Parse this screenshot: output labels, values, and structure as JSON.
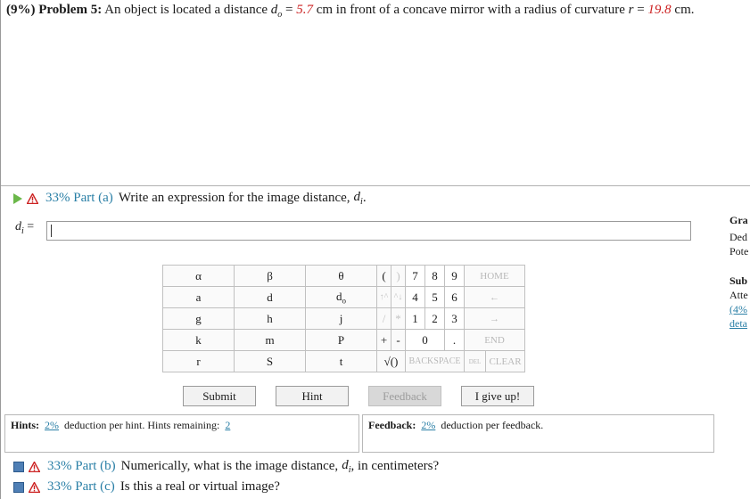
{
  "problem": {
    "weight": "(9%)",
    "label": "Problem 5:",
    "text_before_d": "An object is located a distance",
    "d_symbol": "d",
    "d_subscript": "o",
    "eq": "=",
    "do_value": "5.7",
    "text_mid": "cm in front of a concave mirror with a radius of curvature",
    "r_symbol": "r",
    "r_eq": "=",
    "r_value": "19.8",
    "unit_end": "cm."
  },
  "part_a": {
    "pct": "33% Part (a)",
    "text": "Write an expression for the image distance,",
    "sym": "d",
    "sub": "i",
    "end": "."
  },
  "answer": {
    "label_sym": "d",
    "label_sub": "i",
    "label_eq": "=",
    "value": ""
  },
  "side_panel": {
    "grade_head": "Gra",
    "ded": "Ded",
    "pote": "Pote",
    "sub_head": "Sub",
    "atte": "Atte",
    "pct_link": "(4%",
    "deta": "deta"
  },
  "keypad": {
    "symbols": [
      [
        "α",
        "β",
        "θ"
      ],
      [
        "a",
        "d",
        "d"
      ],
      [
        "g",
        "h",
        "j"
      ],
      [
        "k",
        "m",
        "P"
      ],
      [
        "r",
        "S",
        "t"
      ]
    ],
    "do_sub": "o",
    "paren_open": "(",
    "paren_close": ")",
    "up_left": "↑^",
    "up_right": "^↓",
    "slash": "/",
    "star": "*",
    "plus": "+",
    "minus": "-",
    "sqrt": "√()",
    "digits": [
      [
        "7",
        "8",
        "9"
      ],
      [
        "4",
        "5",
        "6"
      ],
      [
        "1",
        "2",
        "3"
      ]
    ],
    "zero": "0",
    "dot": ".",
    "home": "HOME",
    "left_arrow": "←",
    "right_arrow": "→",
    "end": "END",
    "backspace": "BACKSPACE",
    "del": "DEL",
    "clear": "CLEAR"
  },
  "buttons": {
    "submit": "Submit",
    "hint": "Hint",
    "feedback": "Feedback",
    "give_up": "I give up!"
  },
  "hints": {
    "label": "Hints:",
    "deduction": "2%",
    "text": "deduction per hint. Hints remaining:",
    "remaining": "2"
  },
  "feedback_info": {
    "label": "Feedback:",
    "deduction": "2%",
    "text": "deduction per feedback."
  },
  "part_b": {
    "pct": "33% Part (b)",
    "text": "Numerically, what is the image distance,",
    "sym": "d",
    "sub": "i",
    "end": ", in centimeters?"
  },
  "part_c": {
    "pct": "33% Part (c)",
    "text": "Is this a real or virtual image?"
  },
  "colors": {
    "accent": "#2a7fa6",
    "given_value": "#cc2222",
    "play": "#6bb84a",
    "warning": "#cc2222"
  }
}
